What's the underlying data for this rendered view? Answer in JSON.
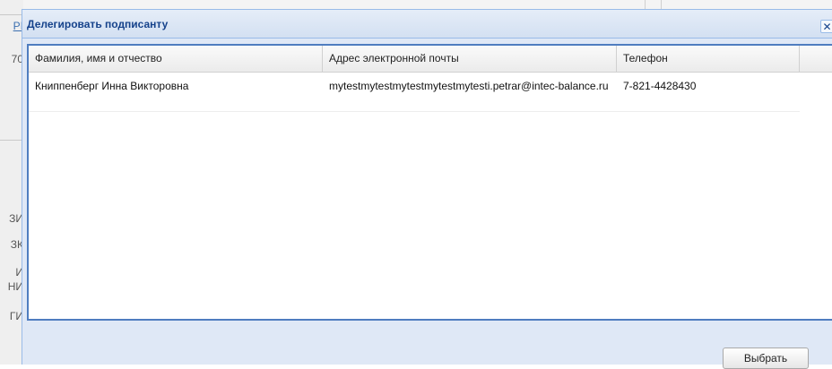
{
  "background": {
    "fragments": [
      "PI",
      "70",
      "ЗИ",
      "ЗК",
      "И",
      "НИ",
      "ГИ"
    ]
  },
  "dialog": {
    "title": "Делегировать подписанту",
    "close_glyph": "✕"
  },
  "grid": {
    "columns": [
      "Фамилия, имя и отчество",
      "Адрес электронной почты",
      "Телефон"
    ],
    "rows": [
      {
        "name": "Книппенберг Инна Викторовна",
        "email": "mytestmytestmytestmytestmytesti.petrar@intec-balance.ru",
        "phone": "7-821-4428430"
      }
    ]
  },
  "footer": {
    "select_label": "Выбрать"
  }
}
